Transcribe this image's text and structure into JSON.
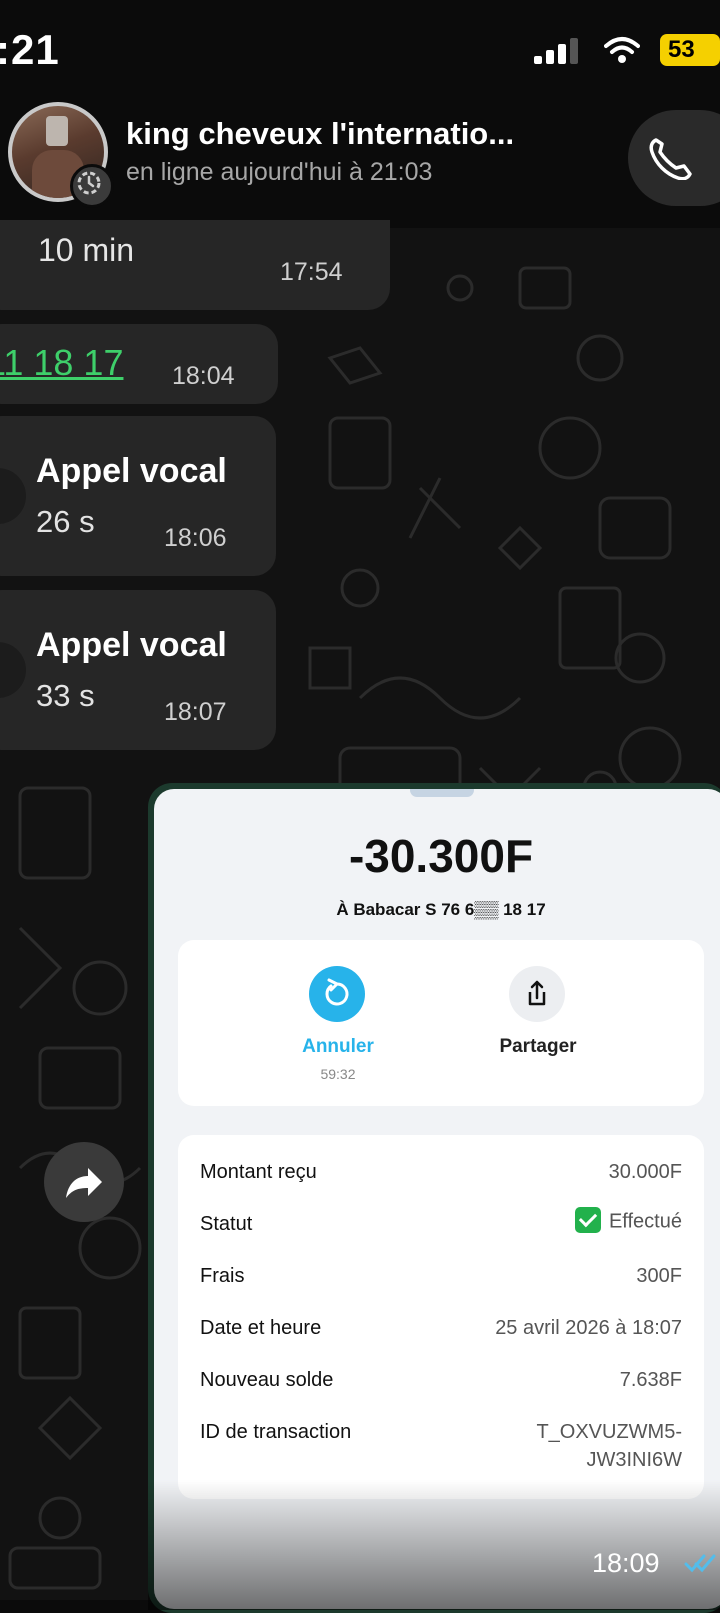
{
  "status_bar": {
    "time": ":21",
    "battery": "53",
    "icons": [
      "signal-icon",
      "wifi-icon",
      "battery-icon"
    ]
  },
  "header": {
    "contact_name": "king cheveux l'internatio...",
    "presence": "en ligne aujourd'hui à 21:03",
    "icons": [
      "avatar",
      "status-ring-icon",
      "phone-icon"
    ]
  },
  "messages": [
    {
      "text": "10 min",
      "time": "17:54"
    },
    {
      "text": "11 18 17",
      "time": "18:04"
    },
    {
      "title": "Appel vocal",
      "duration": "26 s",
      "time": "18:06"
    },
    {
      "title": "Appel vocal",
      "duration": "33 s",
      "time": "18:07"
    }
  ],
  "receipt": {
    "amount": "-30.300F",
    "recipient": "À Babacar S 76 6▒▒ 18 17",
    "actions": {
      "cancel_label": "Annuler",
      "cancel_timer": "59:32",
      "share_label": "Partager"
    },
    "details": [
      {
        "label": "Montant reçu",
        "value": "30.000F"
      },
      {
        "label": "Statut",
        "value": "Effectué"
      },
      {
        "label": "Frais",
        "value": "300F"
      },
      {
        "label": "Date et heure",
        "value": "25 avril 2026 à 18:07"
      },
      {
        "label": "Nouveau solde",
        "value": "7.638F"
      },
      {
        "label": "ID de transaction",
        "value": "T_OXVUZWM5-",
        "value2": "JW3INI6W"
      }
    ]
  },
  "image_message": {
    "time": "18:09"
  },
  "colors": {
    "accent_blue": "#27b3ea",
    "link_green": "#3ecf6a",
    "status_check": "#22b14c",
    "battery": "#f5d000",
    "bubble_bg": "#262626"
  }
}
